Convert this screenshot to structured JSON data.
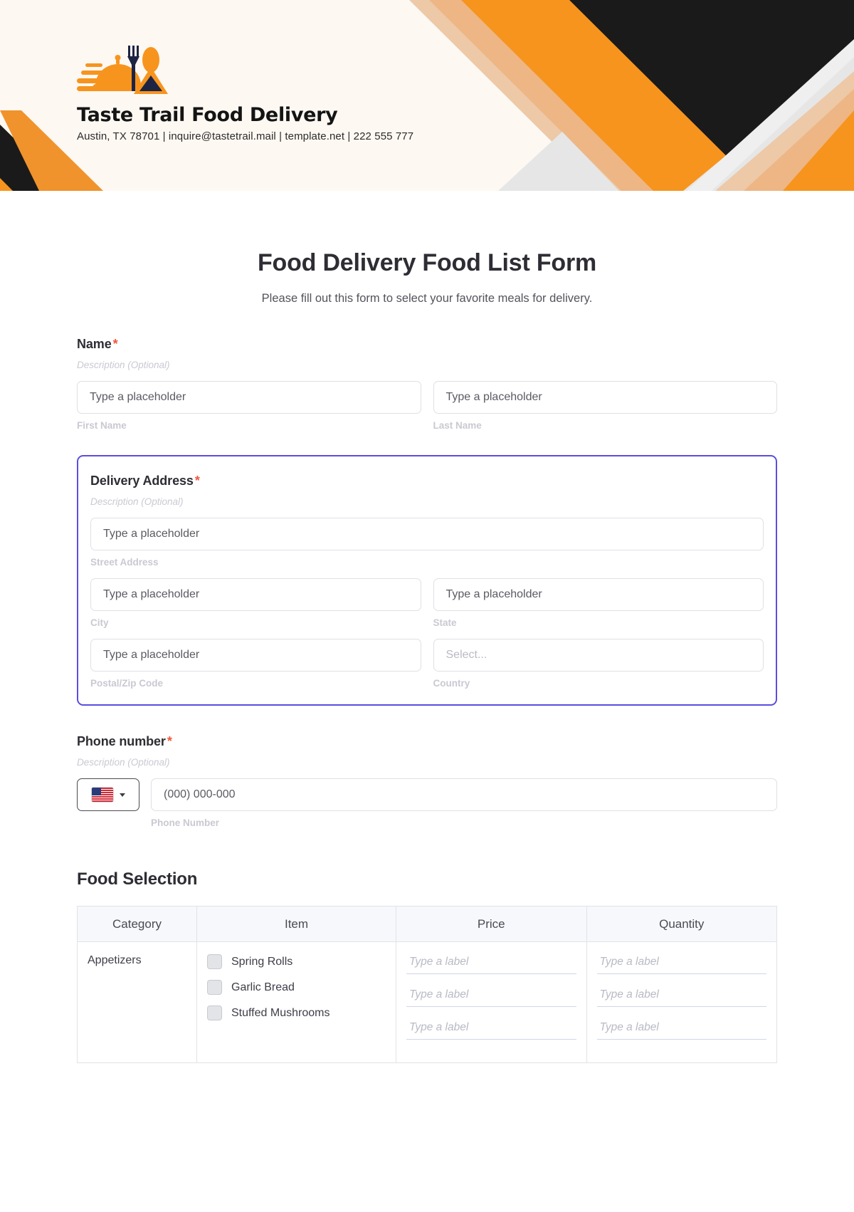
{
  "header": {
    "brand_name": "Taste Trail Food Delivery",
    "contact": "Austin, TX 78701 | inquire@tastetrail.mail | template.net | 222 555 777",
    "logo_icon": "food-cloche-cutlery-icon",
    "colors": {
      "cream": "#fdf8f2",
      "orange": "#f7941e",
      "orange_light": "#f0b27f",
      "orange_pale": "#edc9a8",
      "black": "#1a1a1a",
      "gray": "#e3e3e3"
    }
  },
  "form": {
    "title": "Food Delivery Food List Form",
    "subtitle": "Please fill out this form to select your favorite meals for delivery.",
    "required_marker": "*",
    "description_placeholder": "Description (Optional)",
    "accent_highlight": "#5b4de0"
  },
  "name_field": {
    "label": "Name",
    "description": "Description (Optional)",
    "first": {
      "placeholder": "Type a placeholder",
      "sub_label": "First Name"
    },
    "last": {
      "placeholder": "Type a placeholder",
      "sub_label": "Last Name"
    }
  },
  "address_field": {
    "label": "Delivery Address",
    "description": "Description (Optional)",
    "street": {
      "placeholder": "Type a placeholder",
      "sub_label": "Street Address"
    },
    "city": {
      "placeholder": "Type a placeholder",
      "sub_label": "City"
    },
    "state": {
      "placeholder": "Type a placeholder",
      "sub_label": "State"
    },
    "zip": {
      "placeholder": "Type a placeholder",
      "sub_label": "Postal/Zip Code"
    },
    "country": {
      "placeholder": "Select...",
      "sub_label": "Country"
    }
  },
  "phone_field": {
    "label": "Phone number",
    "description": "Description (Optional)",
    "country_flag": "us-flag-icon",
    "placeholder": "(000) 000-000",
    "sub_label": "Phone Number"
  },
  "food_selection": {
    "title": "Food Selection",
    "columns": [
      "Category",
      "Item",
      "Price",
      "Quantity"
    ],
    "rows": [
      {
        "category": "Appetizers",
        "items": [
          "Spring Rolls",
          "Garlic Bread",
          "Stuffed Mushrooms"
        ],
        "prices": [
          "Type a label",
          "Type a label",
          "Type a label"
        ],
        "quantities": [
          "Type a label",
          "Type a label",
          "Type a label"
        ]
      }
    ]
  }
}
